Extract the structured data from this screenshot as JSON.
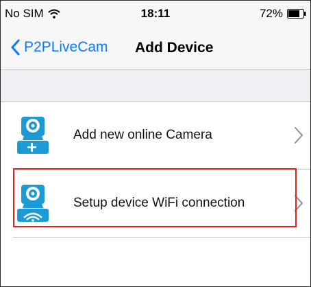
{
  "status_bar": {
    "carrier": "No SIM",
    "time": "18:11",
    "battery": "72%",
    "wifi_icon": "wifi-icon",
    "battery_icon": "battery-icon"
  },
  "nav": {
    "back_label": "P2PLiveCam",
    "title": "Add Device",
    "back_icon": "chevron-back-icon"
  },
  "list": {
    "items": [
      {
        "label": "Add new online Camera",
        "icon": "camera-add-icon"
      },
      {
        "label": "Setup device WiFi connection",
        "icon": "camera-wifi-icon"
      }
    ]
  },
  "colors": {
    "accent": "#0a7aff",
    "icon_blue": "#1b9ad6",
    "highlight": "#e2211c"
  }
}
